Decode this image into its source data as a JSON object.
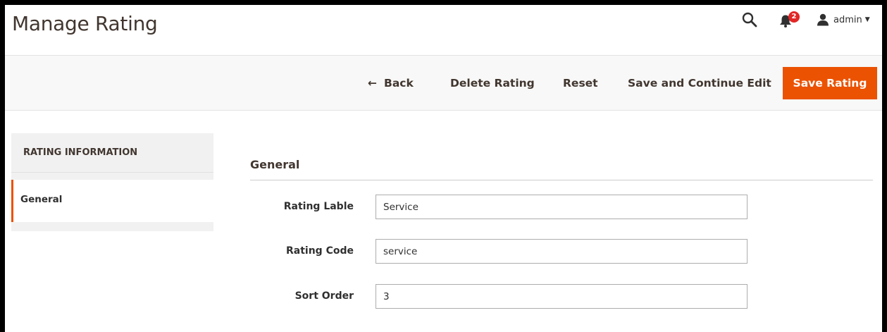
{
  "header": {
    "title": "Manage Rating",
    "notification_count": "2",
    "user_name": "admin",
    "icons": [
      "search-icon",
      "bell-icon",
      "user-icon",
      "caret-down-icon"
    ]
  },
  "actions": {
    "back_label": "Back",
    "delete_label": "Delete Rating",
    "reset_label": "Reset",
    "save_continue_label": "Save and Continue Edit",
    "save_label": "Save Rating"
  },
  "sidebar": {
    "heading": "RATING INFORMATION",
    "items": [
      {
        "label": "General",
        "active": true
      }
    ]
  },
  "form": {
    "section_title": "General",
    "fields": [
      {
        "label": "Rating Lable",
        "value": "Service"
      },
      {
        "label": "Rating Code",
        "value": "service"
      },
      {
        "label": "Sort Order",
        "value": "3"
      }
    ]
  },
  "colors": {
    "accent": "#eb5202",
    "badge": "#e22626",
    "title": "#41362f"
  }
}
